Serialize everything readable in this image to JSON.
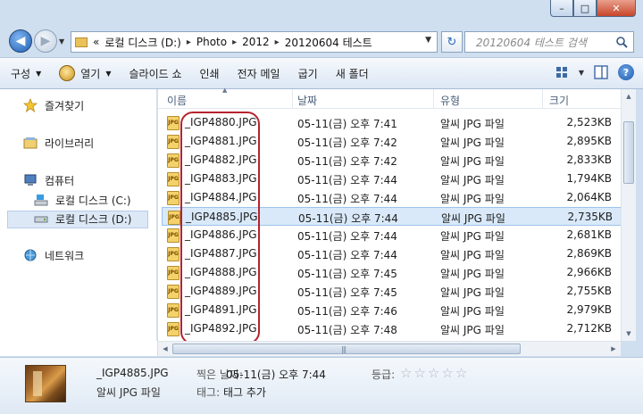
{
  "window": {
    "caption_buttons": {
      "minimize": "–",
      "maximize": "□",
      "close": "✕"
    }
  },
  "navigation": {
    "back_label": "◀",
    "forward_label": "▶",
    "address_prefix": "«",
    "address_path": [
      "로컬 디스크 (D:)",
      "Photo",
      "2012",
      "20120604 테스트"
    ],
    "path_separator": "▸",
    "search_placeholder": "20120604 테스트 검색",
    "refresh_label": "↻"
  },
  "toolbar": {
    "organize": "구성",
    "open": "열기",
    "slideshow": "슬라이드 쇼",
    "print": "인쇄",
    "email": "전자 메일",
    "burn": "굽기",
    "new_folder": "새 폴더",
    "help": "?"
  },
  "sidebar": {
    "favorites": "즐겨찾기",
    "libraries": "라이브러리",
    "computer": "컴퓨터",
    "drive_c": "로컬 디스크 (C:)",
    "drive_d": "로컬 디스크 (D:)",
    "network": "네트워크"
  },
  "columns": {
    "name": "이름",
    "date": "날짜",
    "type": "유형",
    "size": "크기",
    "sort_indicator": "▲"
  },
  "files": [
    {
      "name": "_IGP4880.JPG",
      "date": "05-11(금) 오후 7:41",
      "type": "알씨 JPG 파일",
      "size": "2,523KB"
    },
    {
      "name": "_IGP4881.JPG",
      "date": "05-11(금) 오후 7:42",
      "type": "알씨 JPG 파일",
      "size": "2,895KB"
    },
    {
      "name": "_IGP4882.JPG",
      "date": "05-11(금) 오후 7:42",
      "type": "알씨 JPG 파일",
      "size": "2,833KB"
    },
    {
      "name": "_IGP4883.JPG",
      "date": "05-11(금) 오후 7:44",
      "type": "알씨 JPG 파일",
      "size": "1,794KB"
    },
    {
      "name": "_IGP4884.JPG",
      "date": "05-11(금) 오후 7:44",
      "type": "알씨 JPG 파일",
      "size": "2,064KB"
    },
    {
      "name": "_IGP4885.JPG",
      "date": "05-11(금) 오후 7:44",
      "type": "알씨 JPG 파일",
      "size": "2,735KB",
      "selected": true
    },
    {
      "name": "_IGP4886.JPG",
      "date": "05-11(금) 오후 7:44",
      "type": "알씨 JPG 파일",
      "size": "2,681KB"
    },
    {
      "name": "_IGP4887.JPG",
      "date": "05-11(금) 오후 7:44",
      "type": "알씨 JPG 파일",
      "size": "2,869KB"
    },
    {
      "name": "_IGP4888.JPG",
      "date": "05-11(금) 오후 7:45",
      "type": "알씨 JPG 파일",
      "size": "2,966KB"
    },
    {
      "name": "_IGP4889.JPG",
      "date": "05-11(금) 오후 7:45",
      "type": "알씨 JPG 파일",
      "size": "2,755KB"
    },
    {
      "name": "_IGP4891.JPG",
      "date": "05-11(금) 오후 7:46",
      "type": "알씨 JPG 파일",
      "size": "2,979KB"
    },
    {
      "name": "_IGP4892.JPG",
      "date": "05-11(금) 오후 7:48",
      "type": "알씨 JPG 파일",
      "size": "2,712KB"
    }
  ],
  "file_icon_text": "JPG",
  "details": {
    "name": "_IGP4885.JPG",
    "type": "알씨 JPG 파일",
    "date_label": "찍은 날짜:",
    "date_value": "05-11(금) 오후 7:44",
    "tags_label": "태그:",
    "tags_value": "태그 추가",
    "rating_label": "등급:",
    "rating_value": 0,
    "rating_max": 5
  },
  "colors": {
    "highlight_outline": "#b5232e",
    "selection": "#d9e9f9"
  }
}
